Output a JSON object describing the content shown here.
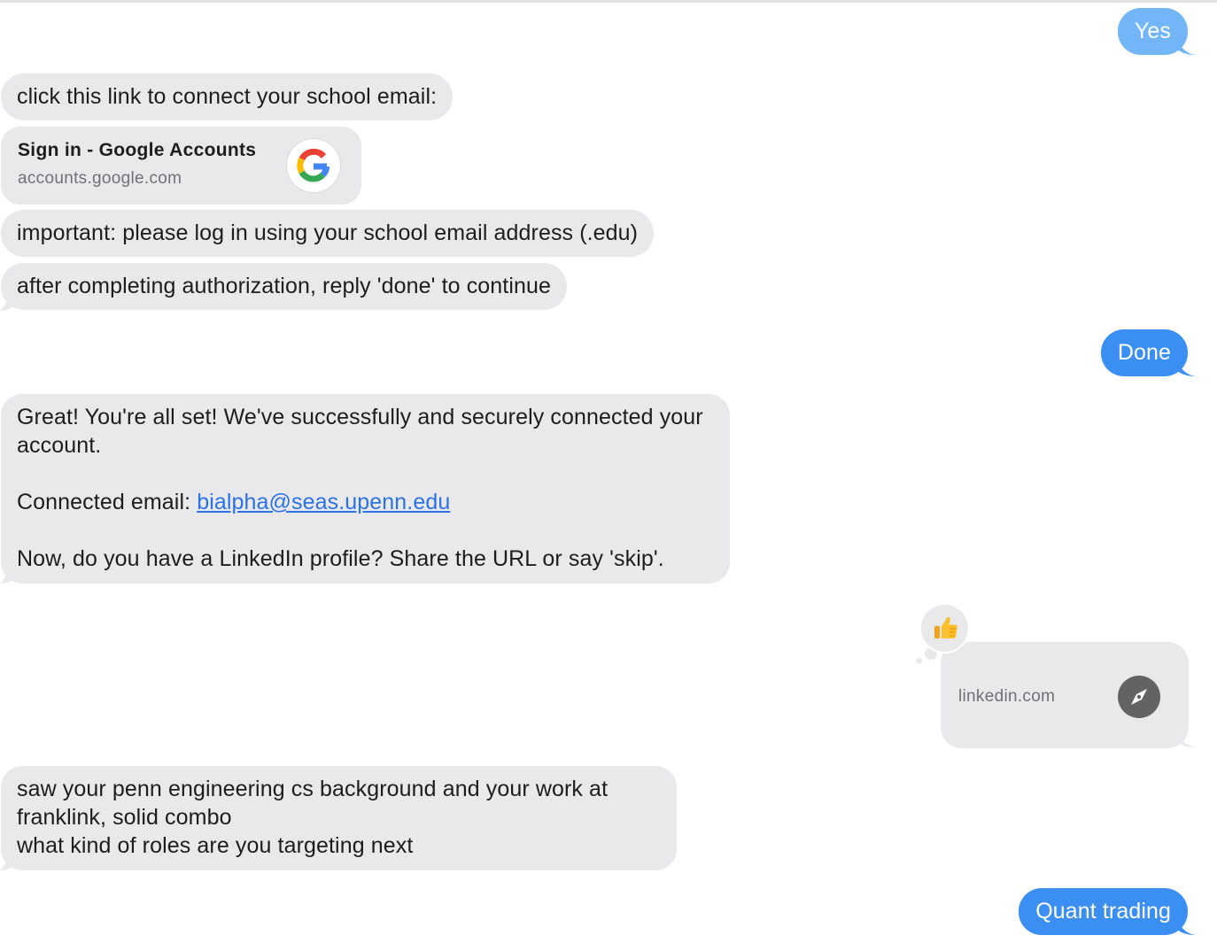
{
  "messages": {
    "yes": "Yes",
    "connect_prompt": "click this link to connect your school email:",
    "google_card": {
      "title": "Sign in - Google Accounts",
      "domain": "accounts.google.com",
      "icon": "google-g-icon"
    },
    "important": "important: please log in using your school email address (.edu)",
    "after_auth": "after completing authorization, reply 'done' to continue",
    "done": "Done",
    "great": {
      "line1": "Great! You're all set! We've successfully and securely connected your account.",
      "email_label": "Connected email: ",
      "email": "bialpha@seas.upenn.edu",
      "line3": "Now, do you have a LinkedIn profile? Share the URL or say 'skip'."
    },
    "linkedin_card": {
      "domain": "linkedin.com",
      "icon": "compass-icon",
      "tapback": "thumbs-up-icon"
    },
    "bot_reply": "saw your penn engineering cs background and your work at franklink, solid combo\nwhat kind of roles are you targeting next",
    "quant": "Quant trading"
  },
  "colors": {
    "incoming_bubble": "#e9e9eb",
    "outgoing_bubble": "#3b8ff3",
    "outgoing_bubble_unread": "#73b6f7",
    "link": "#2a72e6"
  }
}
